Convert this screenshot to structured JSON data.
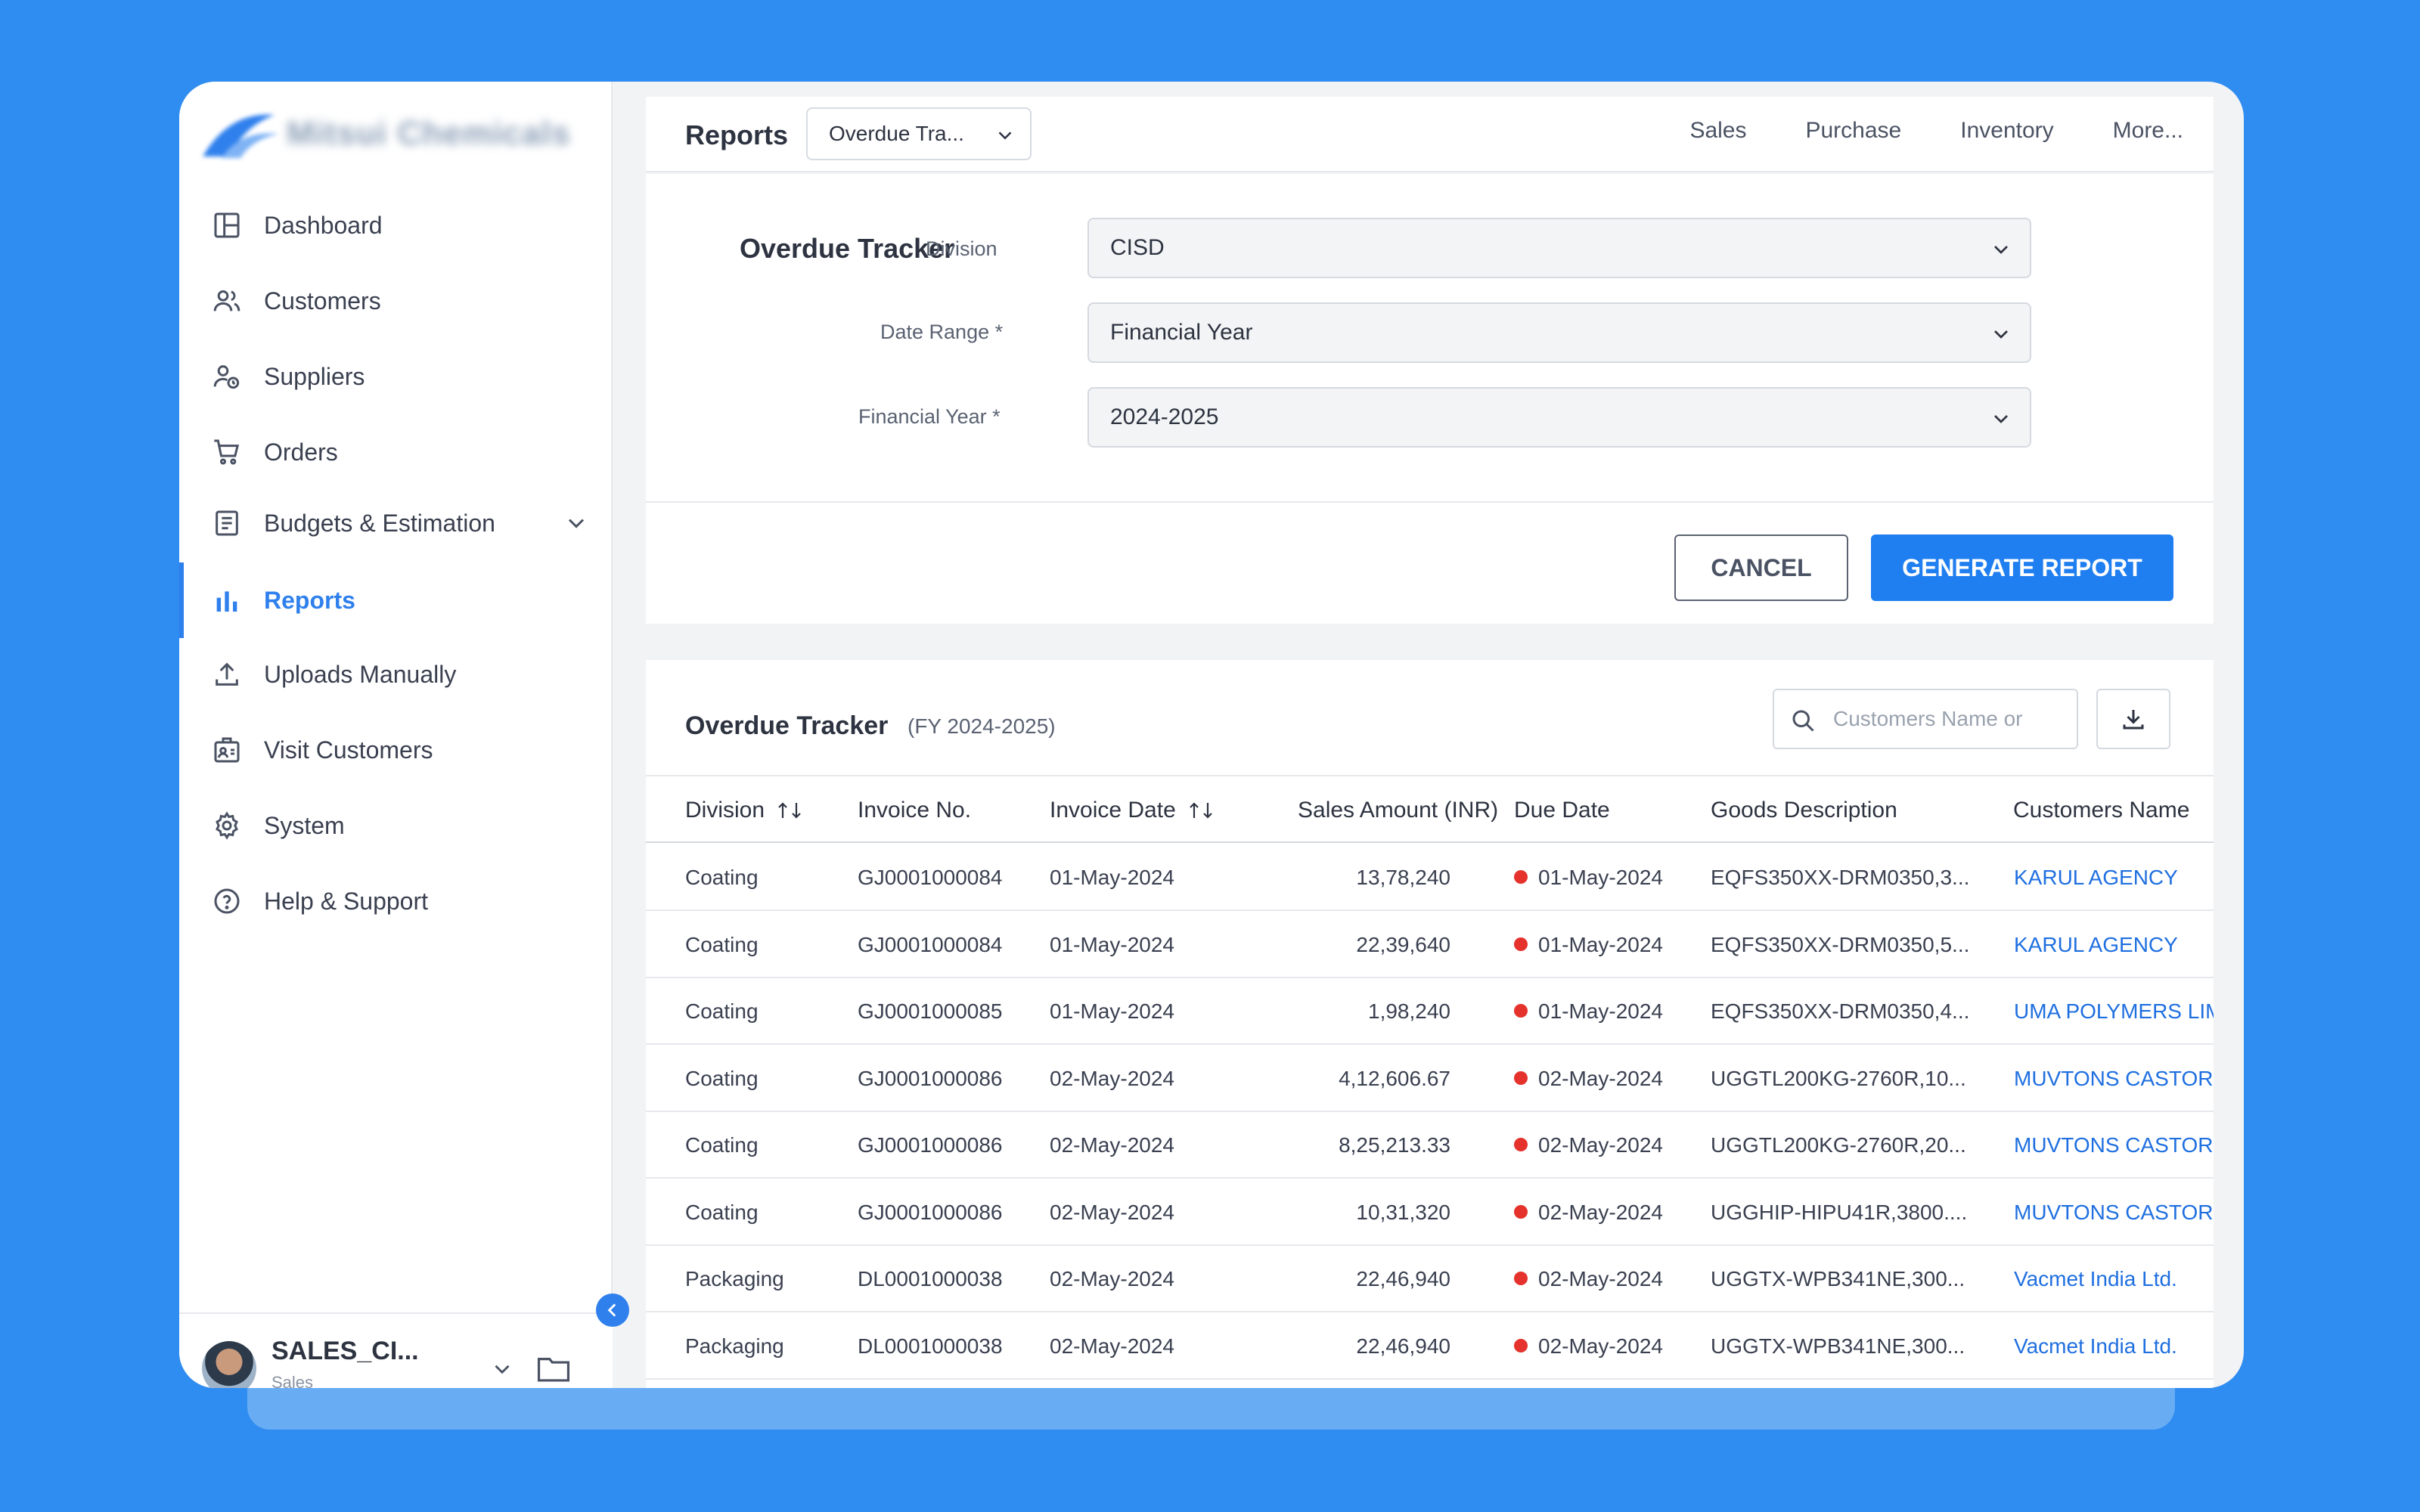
{
  "brand": {
    "name": "Mitsui Chemicals"
  },
  "sidebar": {
    "items": [
      {
        "label": "Dashboard",
        "icon": "dashboard-icon"
      },
      {
        "label": "Customers",
        "icon": "users-icon"
      },
      {
        "label": "Suppliers",
        "icon": "supplier-icon"
      },
      {
        "label": "Orders",
        "icon": "cart-icon"
      },
      {
        "label": "Budgets & Estimation",
        "icon": "budget-icon"
      },
      {
        "label": "Reports",
        "icon": "bar-chart-icon",
        "active": true
      },
      {
        "label": "Uploads Manually",
        "icon": "upload-icon"
      },
      {
        "label": "Visit Customers",
        "icon": "visit-icon"
      },
      {
        "label": "System",
        "icon": "gear-icon"
      },
      {
        "label": "Help & Support",
        "icon": "help-icon"
      }
    ]
  },
  "user": {
    "name": "SALES_CI...",
    "role": "Sales"
  },
  "topbar": {
    "title": "Reports",
    "report_select": "Overdue Tra...",
    "links": [
      "Sales",
      "Purchase",
      "Inventory",
      "More..."
    ]
  },
  "form": {
    "title": "Overdue Tracker",
    "division_label": "Division",
    "division_value": "CISD",
    "date_range_label": "Date Range *",
    "date_range_value": "Financial Year",
    "fy_label": "Financial Year *",
    "fy_value": "2024-2025",
    "cancel_label": "CANCEL",
    "generate_label": "GENERATE REPORT"
  },
  "table": {
    "title": "Overdue Tracker",
    "subtitle": "(FY 2024-2025)",
    "search_placeholder": "Customers Name or",
    "columns": [
      "Division",
      "Invoice No.",
      "Invoice Date",
      "Sales Amount (INR)",
      "Due Date",
      "Goods Description",
      "Customers Name"
    ],
    "rows": [
      {
        "division": "Coating",
        "invoice_no": "GJ0001000084",
        "invoice_date": "01-May-2024",
        "amount": "13,78,240",
        "due_date": "01-May-2024",
        "goods": "EQFS350XX-DRM0350,3...",
        "customer": "KARUL AGENCY"
      },
      {
        "division": "Coating",
        "invoice_no": "GJ0001000084",
        "invoice_date": "01-May-2024",
        "amount": "22,39,640",
        "due_date": "01-May-2024",
        "goods": "EQFS350XX-DRM0350,5...",
        "customer": "KARUL AGENCY"
      },
      {
        "division": "Coating",
        "invoice_no": "GJ0001000085",
        "invoice_date": "01-May-2024",
        "amount": "1,98,240",
        "due_date": "01-May-2024",
        "goods": "EQFS350XX-DRM0350,4...",
        "customer": "UMA POLYMERS LIM"
      },
      {
        "division": "Coating",
        "invoice_no": "GJ0001000086",
        "invoice_date": "02-May-2024",
        "amount": "4,12,606.67",
        "due_date": "02-May-2024",
        "goods": "UGGTL200KG-2760R,10...",
        "customer": "MUVTONS CASTORS"
      },
      {
        "division": "Coating",
        "invoice_no": "GJ0001000086",
        "invoice_date": "02-May-2024",
        "amount": "8,25,213.33",
        "due_date": "02-May-2024",
        "goods": "UGGTL200KG-2760R,20...",
        "customer": "MUVTONS CASTORS"
      },
      {
        "division": "Coating",
        "invoice_no": "GJ0001000086",
        "invoice_date": "02-May-2024",
        "amount": "10,31,320",
        "due_date": "02-May-2024",
        "goods": "UGGHIP-HIPU41R,3800....",
        "customer": "MUVTONS CASTORS"
      },
      {
        "division": "Packaging",
        "invoice_no": "DL0001000038",
        "invoice_date": "02-May-2024",
        "amount": "22,46,940",
        "due_date": "02-May-2024",
        "goods": "UGGTX-WPB341NE,300...",
        "customer": "Vacmet India Ltd."
      },
      {
        "division": "Packaging",
        "invoice_no": "DL0001000038",
        "invoice_date": "02-May-2024",
        "amount": "22,46,940",
        "due_date": "02-May-2024",
        "goods": "UGGTX-WPB341NE,300...",
        "customer": "Vacmet India Ltd."
      }
    ]
  },
  "colors": {
    "accent": "#1f7ef0",
    "background": "#2f8cf0",
    "overdue_dot": "#e5322d",
    "link": "#1f6fe0"
  }
}
